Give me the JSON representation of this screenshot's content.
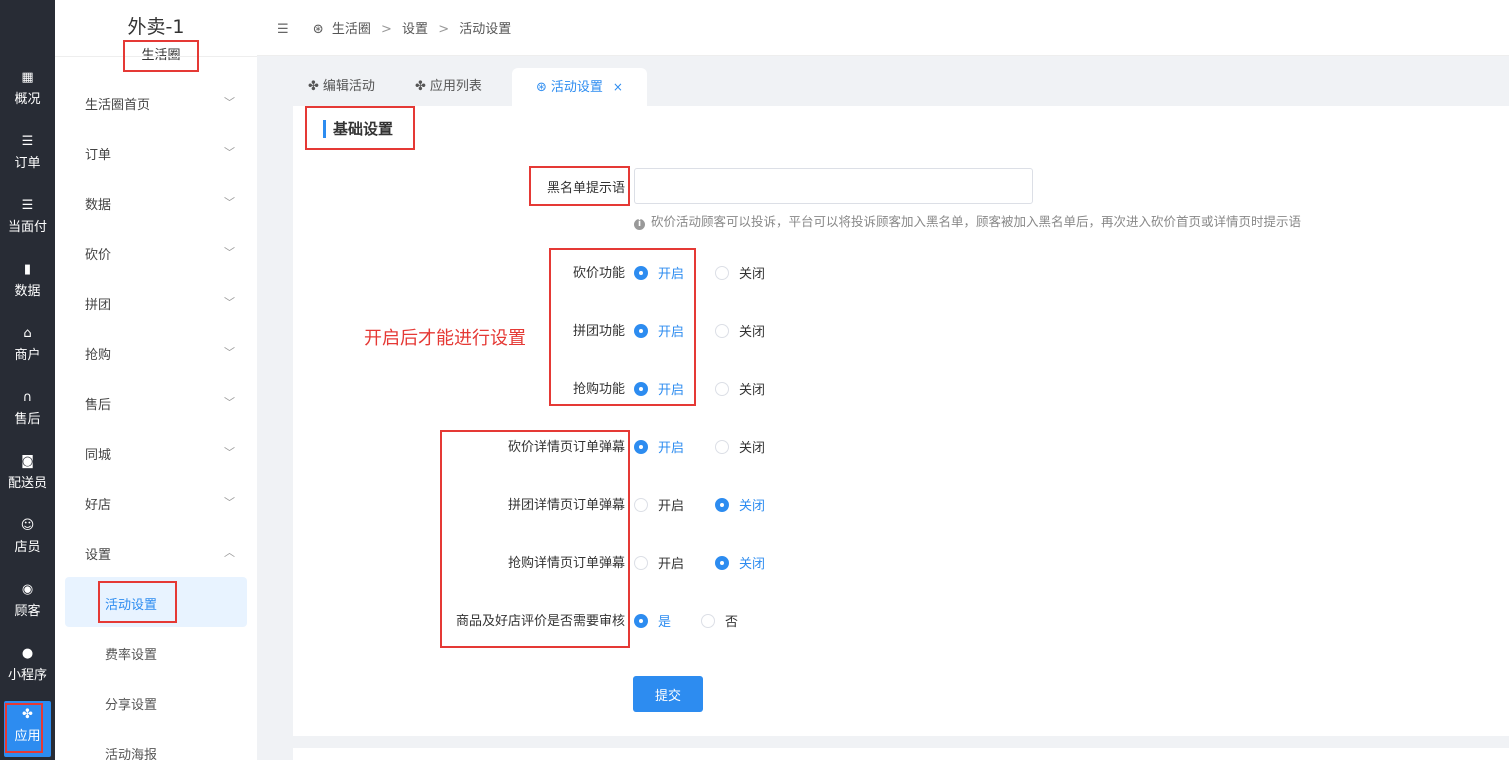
{
  "rail": {
    "items": [
      {
        "label": "概况",
        "icon": "grid-icon"
      },
      {
        "label": "订单",
        "icon": "list-icon"
      },
      {
        "label": "当面付",
        "icon": "list-icon"
      },
      {
        "label": "数据",
        "icon": "bar-chart-icon"
      },
      {
        "label": "商户",
        "icon": "store-icon"
      },
      {
        "label": "售后",
        "icon": "headset-icon"
      },
      {
        "label": "配送员",
        "icon": "delivery-icon"
      },
      {
        "label": "店员",
        "icon": "users-icon"
      },
      {
        "label": "顾客",
        "icon": "user-circle-icon"
      },
      {
        "label": "小程序",
        "icon": "wechat-icon"
      },
      {
        "label": "应用",
        "icon": "apps-icon"
      }
    ]
  },
  "sidebar": {
    "brand": "外卖-1",
    "brand_sub": "生活圈",
    "menu": [
      {
        "label": "生活圈首页",
        "chevron": "﹀"
      },
      {
        "label": "订单",
        "chevron": "﹀"
      },
      {
        "label": "数据",
        "chevron": "﹀"
      },
      {
        "label": "砍价",
        "chevron": "﹀"
      },
      {
        "label": "拼团",
        "chevron": "﹀"
      },
      {
        "label": "抢购",
        "chevron": "﹀"
      },
      {
        "label": "售后",
        "chevron": "﹀"
      },
      {
        "label": "同城",
        "chevron": "﹀"
      },
      {
        "label": "好店",
        "chevron": "﹀"
      },
      {
        "label": "设置",
        "chevron": "︿"
      }
    ],
    "sub": [
      "活动设置",
      "费率设置",
      "分享设置",
      "活动海报"
    ]
  },
  "topbar": {
    "collapse_icon": "☰",
    "crumbs": [
      "生活圈",
      "设置",
      "活动设置"
    ],
    "sep": ">"
  },
  "tabs": [
    {
      "label": "编辑活动"
    },
    {
      "label": "应用列表"
    },
    {
      "label": "活动设置",
      "close": "×"
    }
  ],
  "section": {
    "title": "基础设置"
  },
  "form": {
    "blacklist_label": "黑名单提示语",
    "blacklist_value": "",
    "blacklist_hint": "砍价活动顾客可以投诉，平台可以将投诉顾客加入黑名单，顾客被加入黑名单后，再次进入砍价首页或详情页时提示语",
    "info_mark": "i",
    "rows": [
      {
        "label": "砍价功能",
        "on": "开启",
        "off": "关闭",
        "selected": "on"
      },
      {
        "label": "拼团功能",
        "on": "开启",
        "off": "关闭",
        "selected": "on"
      },
      {
        "label": "抢购功能",
        "on": "开启",
        "off": "关闭",
        "selected": "on"
      },
      {
        "label": "砍价详情页订单弹幕",
        "on": "开启",
        "off": "关闭",
        "selected": "on"
      },
      {
        "label": "拼团详情页订单弹幕",
        "on": "开启",
        "off": "关闭",
        "selected": "off"
      },
      {
        "label": "抢购详情页订单弹幕",
        "on": "开启",
        "off": "关闭",
        "selected": "off"
      },
      {
        "label": "商品及好店评价是否需要审核",
        "on": "是",
        "off": "否",
        "selected": "on"
      }
    ],
    "submit": "提交"
  },
  "annotation": "开启后才能进行设置",
  "colors": {
    "accent": "#2d8cf0",
    "annotation": "#e53935",
    "rail": "#282c35"
  }
}
